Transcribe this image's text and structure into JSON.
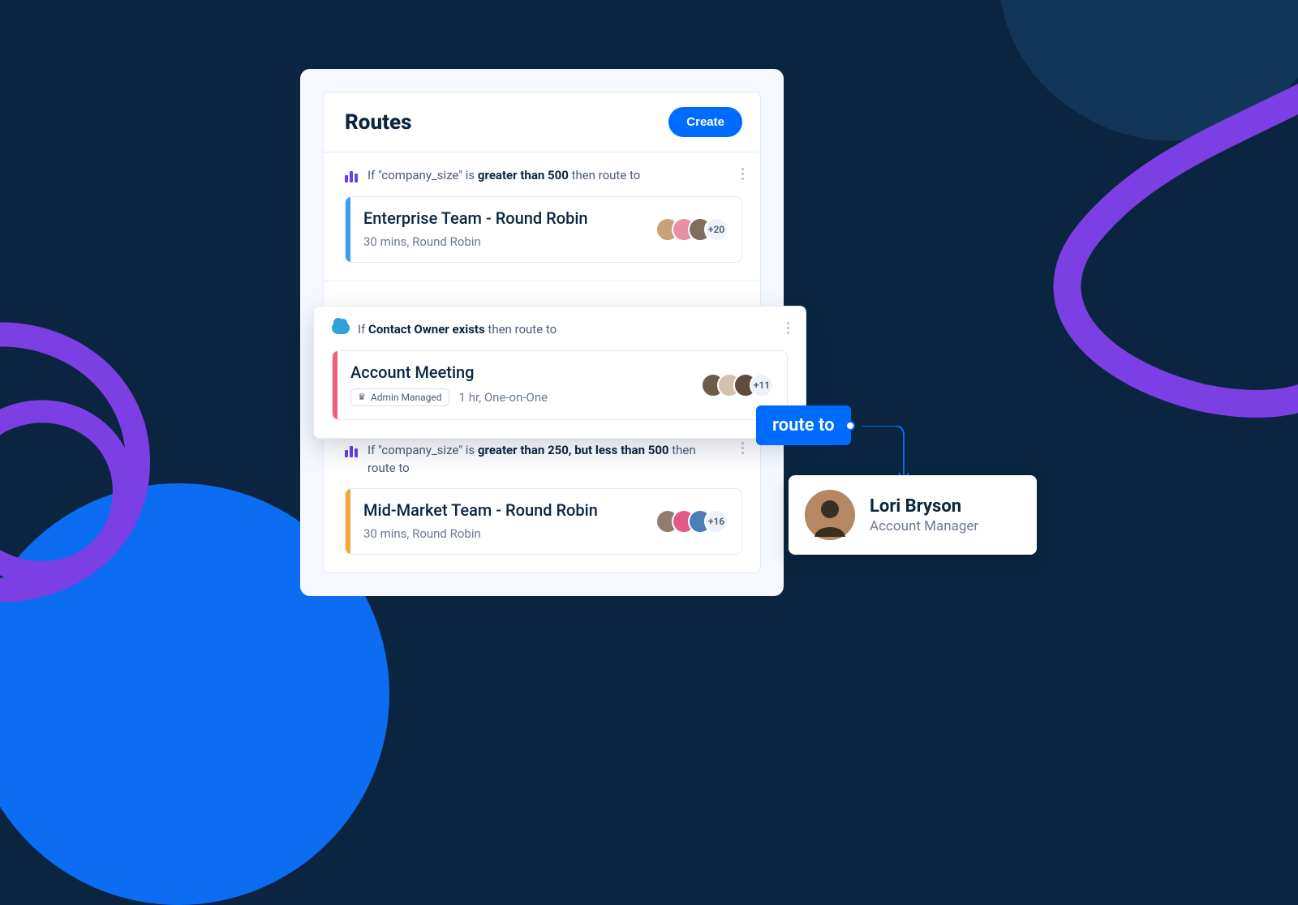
{
  "colors": {
    "accent": "#006BFF",
    "purple": "#7B3FE4",
    "blueShape": "#0C6CF2",
    "navy": "#0B2540"
  },
  "panel": {
    "title": "Routes",
    "create_label": "Create"
  },
  "routes": [
    {
      "icon": "bars",
      "cond_prefix": "If \"company_size\" is ",
      "cond_bold": "greater than 500",
      "cond_suffix": " then route to",
      "event": {
        "stripe": "blue",
        "title": "Enterprise Team - Round Robin",
        "subtitle": "30 mins, Round Robin",
        "admin_managed": false,
        "avatar_colors": [
          "#C9A27A",
          "#E78FA4",
          "#7E6F5F"
        ],
        "more": "+20"
      }
    },
    {
      "icon": "cloud",
      "cond_prefix": "If ",
      "cond_bold": "Contact Owner exists",
      "cond_suffix": " then route to",
      "event": {
        "stripe": "red",
        "title": "Account Meeting",
        "subtitle": "1 hr, One-on-One",
        "admin_managed": true,
        "admin_label": "Admin Managed",
        "avatar_colors": [
          "#6B5B49",
          "#D3C2B0",
          "#5E4B3E"
        ],
        "more": "+11"
      }
    },
    {
      "icon": "bars",
      "cond_prefix": "If \"company_size\" is ",
      "cond_bold": "greater than 250, but less than 500",
      "cond_suffix": " then route to",
      "event": {
        "stripe": "orange",
        "title": "Mid-Market Team - Round Robin",
        "subtitle": "30 mins, Round Robin",
        "admin_managed": false,
        "avatar_colors": [
          "#8F7E6C",
          "#E15A87",
          "#4A7FB5"
        ],
        "more": "+16"
      }
    }
  ],
  "callout": {
    "pill": "route to",
    "person": {
      "name": "Lori Bryson",
      "role": "Account Manager",
      "avatar_bg": "#B58863"
    }
  }
}
